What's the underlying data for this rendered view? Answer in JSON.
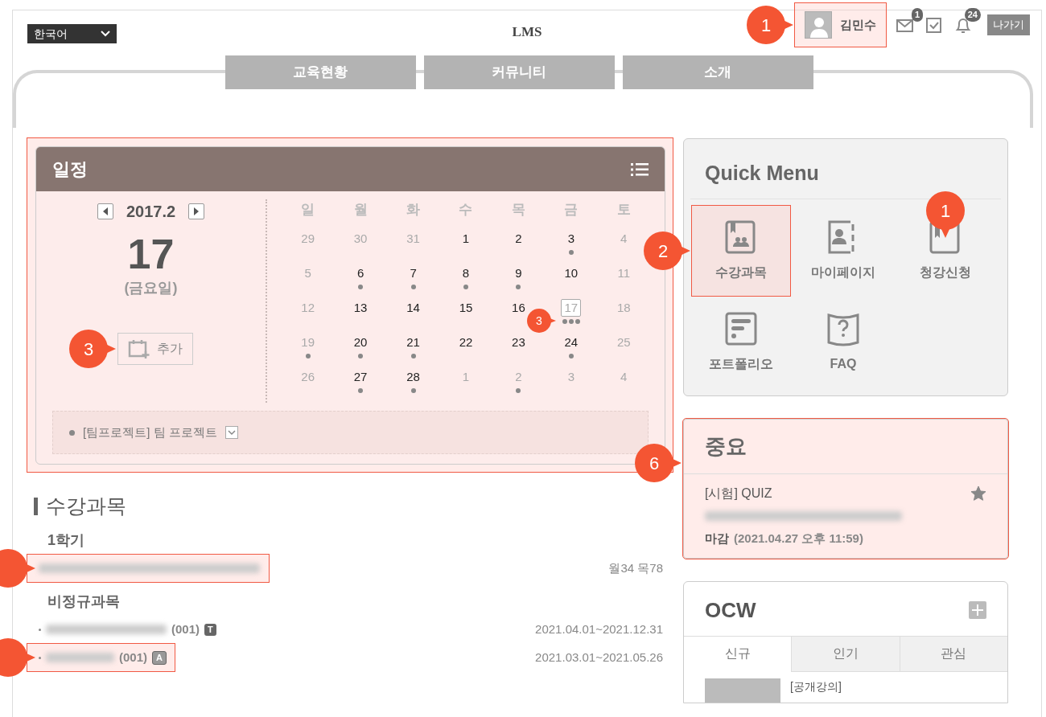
{
  "header": {
    "language": "한국어",
    "logo": "LMS",
    "user": {
      "name": "김민수",
      "highlighted": true,
      "callout": "1"
    },
    "mail_count": "1",
    "alert_count": "24",
    "logout": "나가기"
  },
  "nav": [
    {
      "label": "교육현황"
    },
    {
      "label": "커뮤니티"
    },
    {
      "label": "소개"
    }
  ],
  "schedule": {
    "title": "일정",
    "highlighted": true,
    "month": "2017.2",
    "day": "17",
    "weekday": "(금요일)",
    "add": {
      "label": "추가",
      "callout": "3"
    },
    "weekdays": [
      "일",
      "월",
      "화",
      "수",
      "목",
      "금",
      "토"
    ],
    "weeks": [
      [
        {
          "d": "29",
          "muted": true,
          "event": false
        },
        {
          "d": "30",
          "muted": true,
          "event": false
        },
        {
          "d": "31",
          "muted": true,
          "event": false
        },
        {
          "d": "1",
          "muted": false,
          "event": false
        },
        {
          "d": "2",
          "muted": false,
          "event": false
        },
        {
          "d": "3",
          "muted": false,
          "event": true
        },
        {
          "d": "4",
          "muted": true,
          "event": false
        }
      ],
      [
        {
          "d": "5",
          "muted": true,
          "event": false
        },
        {
          "d": "6",
          "muted": false,
          "event": true
        },
        {
          "d": "7",
          "muted": false,
          "event": true
        },
        {
          "d": "8",
          "muted": false,
          "event": true
        },
        {
          "d": "9",
          "muted": false,
          "event": true
        },
        {
          "d": "10",
          "muted": false,
          "event": false
        },
        {
          "d": "11",
          "muted": true,
          "event": false
        }
      ],
      [
        {
          "d": "12",
          "muted": true,
          "event": false
        },
        {
          "d": "13",
          "muted": false,
          "event": false
        },
        {
          "d": "14",
          "muted": false,
          "event": false
        },
        {
          "d": "15",
          "muted": false,
          "event": false
        },
        {
          "d": "16",
          "muted": false,
          "event": false
        },
        {
          "d": "17",
          "muted": true,
          "event": true,
          "many": true,
          "selected": true,
          "callout": "3"
        },
        {
          "d": "18",
          "muted": true,
          "event": false
        }
      ],
      [
        {
          "d": "19",
          "muted": true,
          "event": true
        },
        {
          "d": "20",
          "muted": false,
          "event": true
        },
        {
          "d": "21",
          "muted": false,
          "event": true
        },
        {
          "d": "22",
          "muted": false,
          "event": false
        },
        {
          "d": "23",
          "muted": false,
          "event": false
        },
        {
          "d": "24",
          "muted": false,
          "event": true
        },
        {
          "d": "25",
          "muted": true,
          "event": false
        }
      ],
      [
        {
          "d": "26",
          "muted": true,
          "event": false
        },
        {
          "d": "27",
          "muted": false,
          "event": true
        },
        {
          "d": "28",
          "muted": false,
          "event": true
        },
        {
          "d": "1",
          "muted": true,
          "event": false
        },
        {
          "d": "2",
          "muted": true,
          "event": true
        },
        {
          "d": "3",
          "muted": true,
          "event": false
        },
        {
          "d": "4",
          "muted": true,
          "event": false
        }
      ]
    ],
    "event": "[팀프로젝트] 팀 프로젝트"
  },
  "courses": {
    "title": "수강과목",
    "groups": [
      {
        "name": "1학기",
        "rows": [
          {
            "kind": "regular",
            "schedule": "월34 목78",
            "highlighted": true,
            "callout_cut": true
          }
        ]
      },
      {
        "name": "비정규과목",
        "rows": [
          {
            "kind": "informal",
            "code": "(001)",
            "badge": "T",
            "period": "2021.04.01~2021.12.31",
            "highlighted": false,
            "callout_cut": false
          },
          {
            "kind": "informal",
            "code": "(001)",
            "badge": "A",
            "period": "2021.03.01~2021.05.26",
            "highlighted": true,
            "callout_cut": true
          }
        ]
      }
    ]
  },
  "quick_menu": {
    "title": "Quick Menu",
    "items": [
      {
        "label": "수강과목",
        "kind": "book",
        "highlighted": true,
        "callout": "2",
        "callout_above": false
      },
      {
        "label": "마이페이지",
        "kind": "contact",
        "highlighted": false
      },
      {
        "label": "청강신청",
        "kind": "bookmark",
        "highlighted": false,
        "callout": "1",
        "callout_above": true
      },
      {
        "label": "포트폴리오",
        "kind": "list",
        "highlighted": false
      },
      {
        "label": "FAQ",
        "kind": "help",
        "highlighted": false
      }
    ]
  },
  "important": {
    "title": "중요",
    "highlighted": true,
    "callout": "6",
    "category": "[시험] QUIZ",
    "starred": true,
    "deadline_label": "마감",
    "deadline": "(2021.04.27 오후 11:59)"
  },
  "ocw": {
    "title": "OCW",
    "tabs": [
      {
        "label": "신규",
        "selected": true
      },
      {
        "label": "인기",
        "selected": false
      },
      {
        "label": "관심",
        "selected": false
      }
    ],
    "item": "[공개강의]"
  }
}
